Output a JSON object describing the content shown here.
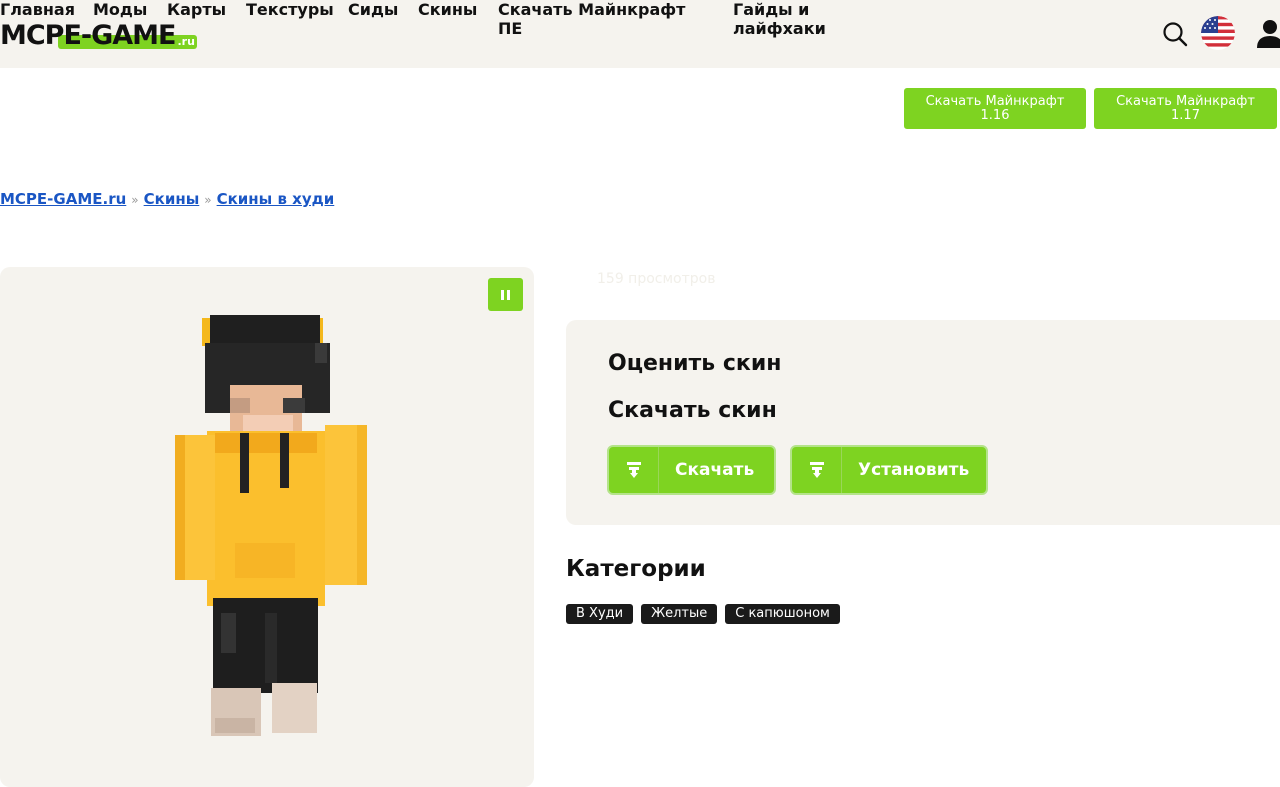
{
  "header": {
    "logo_main": "MCPE-GAME",
    "logo_suffix": ".ru"
  },
  "nav": {
    "items": [
      "Главная",
      "Моды",
      "Карты",
      "Текстуры",
      "Сиды",
      "Скины",
      "Скачать Майнкрафт ПЕ",
      "Гайды и лайфхаки"
    ],
    "buttons": [
      "Скачать Майнкрафт 1.16",
      "Скачать Майнкрафт 1.17"
    ],
    "accent": "#7ed321"
  },
  "breadcrumb": [
    "MCPE-GAME.ru",
    "Скины",
    "Скины в худи"
  ],
  "breadcrumb_sep": "»",
  "views": "159 просмотров",
  "card": {
    "rate_title": "Оценить скин",
    "download_title": "Скачать скин",
    "download_btn": "Скачать",
    "install_btn": "Установить"
  },
  "categories": {
    "title": "Категории",
    "tags": [
      "В Худи",
      "Желтые",
      "С капюшоном"
    ]
  }
}
